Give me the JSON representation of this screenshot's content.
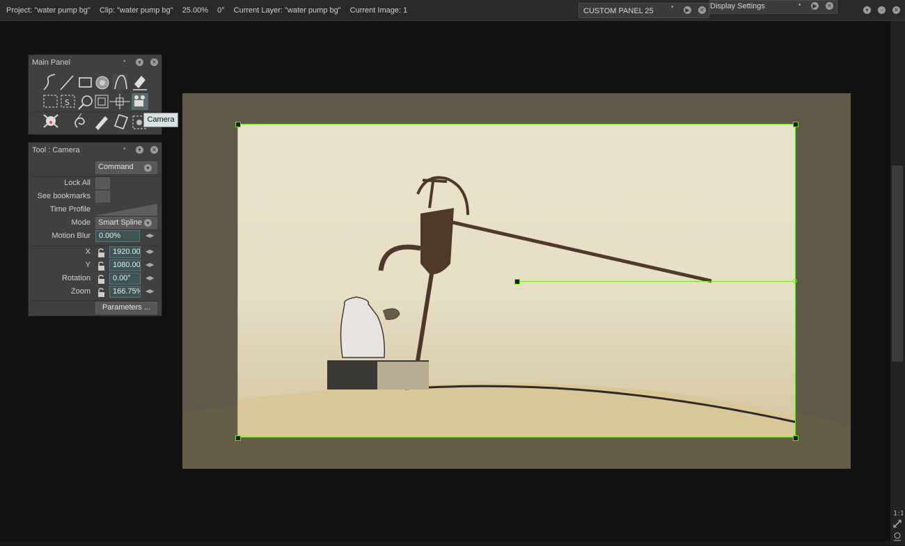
{
  "status_bar": {
    "project": "Project:  \"water pump bg\"",
    "clip": "Clip:  \"water pump bg\"",
    "zoom": "25.00%",
    "angle": "0°",
    "current_layer": "Current Layer:  \"water pump bg\"",
    "current_image": "Current Image:  1"
  },
  "tabs": {
    "custom_panel": "CUSTOM PANEL 25",
    "display_settings": "Display Settings"
  },
  "main_panel": {
    "title": "Main Panel",
    "tools": [
      "freehand-stroke-icon",
      "line-icon",
      "rectangle-icon",
      "disk-icon",
      "bezier-icon",
      "eraser-icon",
      "lasso-select-icon",
      "shape-select-icon",
      "magnify-icon",
      "transform-icon",
      "move-icon",
      "camera-icon",
      "skull-icon",
      "swirl-icon",
      "pen-icon",
      "paper-icon",
      "settings-icon"
    ],
    "tooltip": "Camera"
  },
  "tool_panel": {
    "title": "Tool : Camera",
    "command_label": "Command",
    "lock_all_label": "Lock All",
    "see_bookmarks_label": "See bookmarks",
    "time_profile_label": "Time Profile",
    "mode_label": "Mode",
    "mode_value": "Smart Spline",
    "motion_blur_label": "Motion Blur",
    "motion_blur_value": "0.00%",
    "x_label": "X",
    "x_value": "1920.00",
    "y_label": "Y",
    "y_value": "1080.00",
    "rotation_label": "Rotation",
    "rotation_value": "0.00°",
    "zoom_label": "Zoom",
    "zoom_value": "166.75%",
    "parameters_button": "Parameters ..."
  },
  "colors": {
    "camera_frame": "#6fe41e",
    "background": "#121212",
    "panel": "#404040"
  }
}
